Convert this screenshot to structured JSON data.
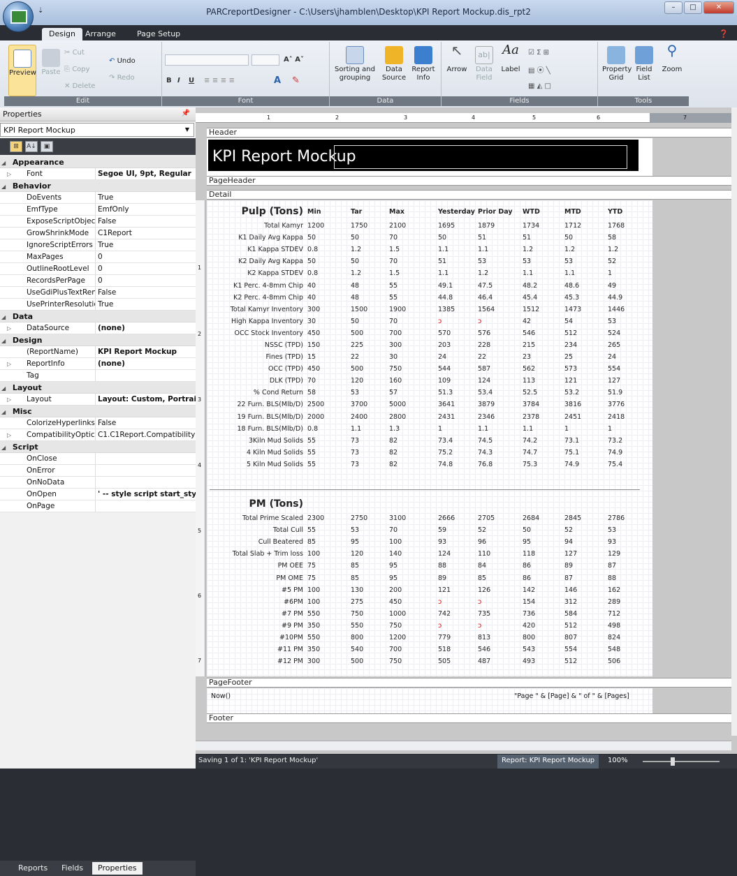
{
  "window": {
    "title": "PARCreportDesigner - C:\\Users\\jhamblen\\Desktop\\KPI Report Mockup.dis_rpt2",
    "qat": "⇣"
  },
  "ribbon_tabs": [
    {
      "label": "Design"
    },
    {
      "label": "Arrange"
    },
    {
      "label": "Page Setup"
    }
  ],
  "ribbon": {
    "edit": {
      "label": "Edit",
      "preview": "Preview",
      "paste": "Paste",
      "cut": "Cut",
      "copy": "Copy",
      "delete": "Delete",
      "undo": "Undo",
      "redo": "Redo"
    },
    "font": {
      "label": "Font",
      "bold": "B",
      "italic": "I",
      "underline": "U"
    },
    "data": {
      "label": "Data",
      "sorting1": "Sorting and",
      "sorting2": "grouping",
      "source1": "Data",
      "source2": "Source",
      "info1": "Report",
      "info2": "Info"
    },
    "fields": {
      "label": "Fields",
      "arrow": "Arrow",
      "datafield1": "Data",
      "datafield2": "Field",
      "label_btn": "Label"
    },
    "tools": {
      "label": "Tools",
      "propgrid1": "Property",
      "propgrid2": "Grid",
      "fieldlist1": "Field",
      "fieldlist2": "List",
      "zoom": "Zoom"
    }
  },
  "properties": {
    "header": "Properties",
    "pin": "ᵖ",
    "object": "KPI Report Mockup",
    "sections": [
      {
        "name": "Appearance",
        "rows": [
          {
            "name": "Font",
            "value": "Segoe UI, 9pt, Regular",
            "bold": true,
            "exp": true
          }
        ]
      },
      {
        "name": "Behavior",
        "rows": [
          {
            "name": "DoEvents",
            "value": "True"
          },
          {
            "name": "EmfType",
            "value": "EmfOnly"
          },
          {
            "name": "ExposeScriptObject",
            "value": "False"
          },
          {
            "name": "GrowShrinkMode",
            "value": "C1Report"
          },
          {
            "name": "IgnoreScriptErrors",
            "value": "True"
          },
          {
            "name": "MaxPages",
            "value": "0"
          },
          {
            "name": "OutlineRootLevel",
            "value": "0"
          },
          {
            "name": "RecordsPerPage",
            "value": "0"
          },
          {
            "name": "UseGdiPlusTextRen",
            "value": "False"
          },
          {
            "name": "UsePrinterResolutic",
            "value": "True"
          }
        ]
      },
      {
        "name": "Data",
        "rows": [
          {
            "name": "DataSource",
            "value": "(none)",
            "bold": true,
            "exp": true
          }
        ]
      },
      {
        "name": "Design",
        "rows": [
          {
            "name": "(ReportName)",
            "value": "KPI Report Mockup",
            "bold": true
          },
          {
            "name": "ReportInfo",
            "value": "(none)",
            "bold": true,
            "exp": true
          },
          {
            "name": "Tag",
            "value": ""
          }
        ]
      },
      {
        "name": "Layout",
        "rows": [
          {
            "name": "Layout",
            "value": "Layout: Custom, Portrait",
            "bold": true,
            "exp": true
          }
        ]
      },
      {
        "name": "Misc",
        "rows": [
          {
            "name": "ColorizeHyperlinks",
            "value": "False"
          },
          {
            "name": "CompatibilityOptic",
            "value": "C1.C1Report.Compatibility",
            "exp": true
          }
        ]
      },
      {
        "name": "Script",
        "rows": [
          {
            "name": "OnClose",
            "value": ""
          },
          {
            "name": "OnError",
            "value": ""
          },
          {
            "name": "OnNoData",
            "value": ""
          },
          {
            "name": "OnOpen",
            "value": "' -- style script start_style",
            "bold": true
          },
          {
            "name": "OnPage",
            "value": ""
          }
        ]
      }
    ]
  },
  "bottom_tabs": [
    {
      "label": "Reports"
    },
    {
      "label": "Fields"
    },
    {
      "label": "Properties"
    }
  ],
  "ruler": [
    "1",
    "2",
    "3",
    "4",
    "5",
    "6",
    "7"
  ],
  "vruler": [
    "1",
    "2",
    "3",
    "4",
    "5",
    "6",
    "7"
  ],
  "bands": {
    "header": "Header",
    "page_header": "PageHeader",
    "detail": "Detail",
    "page_footer": "PageFooter",
    "footer": "Footer"
  },
  "report": {
    "title": "KPI Report Mockup",
    "columns": [
      "Min",
      "Tar",
      "Max",
      "Yesterday",
      "Prior Day",
      "WTD",
      "MTD",
      "YTD"
    ],
    "pulp": {
      "title": "Pulp (Tons)",
      "rows": [
        [
          "Total Kamyr",
          "1200",
          "1750",
          "2100",
          "1695",
          "1879",
          "1734",
          "1712",
          "1768"
        ],
        [
          "K1 Daily Avg Kappa",
          "50",
          "50",
          "70",
          "50",
          "51",
          "51",
          "50",
          "58"
        ],
        [
          "K1 Kappa STDEV",
          "0.8",
          "1.2",
          "1.5",
          "1.1",
          "1.1",
          "1.2",
          "1.2",
          "1.2"
        ],
        [
          "K2 Daily Avg Kappa",
          "50",
          "50",
          "70",
          "51",
          "53",
          "53",
          "53",
          "52"
        ],
        [
          "K2 Kappa STDEV",
          "0.8",
          "1.2",
          "1.5",
          "1.1",
          "1.2",
          "1.1",
          "1.1",
          "1"
        ],
        [
          "K1 Perc. 4-8mm Chip",
          "40",
          "48",
          "55",
          "49.1",
          "47.5",
          "48.2",
          "48.6",
          "49"
        ],
        [
          "K2 Perc. 4-8mm Chip",
          "40",
          "48",
          "55",
          "44.8",
          "46.4",
          "45.4",
          "45.3",
          "44.9"
        ],
        [
          "Total Kamyr Inventory",
          "300",
          "1500",
          "1900",
          "1385",
          "1564",
          "1512",
          "1473",
          "1446"
        ],
        [
          "High Kappa Inventory",
          "30",
          "50",
          "70",
          "0",
          "0",
          "42",
          "54",
          "53"
        ],
        [
          "OCC Stock Inventory",
          "450",
          "500",
          "700",
          "570",
          "576",
          "546",
          "512",
          "524"
        ],
        [
          "NSSC (TPD)",
          "150",
          "225",
          "300",
          "203",
          "228",
          "215",
          "234",
          "265"
        ],
        [
          "Fines (TPD)",
          "15",
          "22",
          "30",
          "24",
          "22",
          "23",
          "25",
          "24"
        ],
        [
          "OCC (TPD)",
          "450",
          "500",
          "750",
          "544",
          "587",
          "562",
          "573",
          "554"
        ],
        [
          "DLK (TPD)",
          "70",
          "120",
          "160",
          "109",
          "124",
          "113",
          "121",
          "127"
        ],
        [
          "% Cond Return",
          "58",
          "53",
          "57",
          "51.3",
          "53.4",
          "52.5",
          "53.2",
          "51.9"
        ],
        [
          "22 Furn. BLS(Mlb/D)",
          "2500",
          "3700",
          "5000",
          "3641",
          "3879",
          "3784",
          "3816",
          "3776"
        ],
        [
          "19 Furn. BLS(Mlb/D)",
          "2000",
          "2400",
          "2800",
          "2431",
          "2346",
          "2378",
          "2451",
          "2418"
        ],
        [
          "18 Furn. BLS(Mlb/D)",
          "0.8",
          "1.1",
          "1.3",
          "1",
          "1.1",
          "1.1",
          "1",
          "1"
        ],
        [
          "3Kiln Mud Solids",
          "55",
          "73",
          "82",
          "73.4",
          "74.5",
          "74.2",
          "73.1",
          "73.2"
        ],
        [
          "4 Kiln Mud Solids",
          "55",
          "73",
          "82",
          "75.2",
          "74.3",
          "74.7",
          "75.1",
          "74.9"
        ],
        [
          "5 Kiln Mud Solids",
          "55",
          "73",
          "82",
          "74.8",
          "76.8",
          "75.3",
          "74.9",
          "75.4"
        ]
      ]
    },
    "pm": {
      "title": "PM (Tons)",
      "rows": [
        [
          "Total Prime Scaled",
          "2300",
          "2750",
          "3100",
          "2666",
          "2705",
          "2684",
          "2845",
          "2786"
        ],
        [
          "Total Cull",
          "55",
          "53",
          "70",
          "59",
          "52",
          "50",
          "52",
          "53"
        ],
        [
          "Cull Beatered",
          "85",
          "95",
          "100",
          "93",
          "96",
          "95",
          "94",
          "93"
        ],
        [
          "Total Slab + Trim loss",
          "100",
          "120",
          "140",
          "124",
          "110",
          "118",
          "127",
          "129"
        ],
        [
          "PM OEE",
          "75",
          "85",
          "95",
          "88",
          "84",
          "86",
          "89",
          "87"
        ],
        [
          "PM OME",
          "75",
          "85",
          "95",
          "89",
          "85",
          "86",
          "87",
          "88"
        ],
        [
          "#5 PM",
          "100",
          "130",
          "200",
          "121",
          "126",
          "142",
          "146",
          "162"
        ],
        [
          "#6PM",
          "100",
          "275",
          "450",
          "0",
          "0",
          "154",
          "312",
          "289"
        ],
        [
          "#7 PM",
          "550",
          "750",
          "1000",
          "742",
          "735",
          "736",
          "584",
          "712"
        ],
        [
          "#9 PM",
          "350",
          "550",
          "750",
          "0",
          "0",
          "420",
          "512",
          "498"
        ],
        [
          "#10PM",
          "550",
          "800",
          "1200",
          "779",
          "813",
          "800",
          "807",
          "824"
        ],
        [
          "#11 PM",
          "350",
          "540",
          "700",
          "518",
          "546",
          "543",
          "554",
          "548"
        ],
        [
          "#12 PM",
          "300",
          "500",
          "750",
          "505",
          "487",
          "493",
          "512",
          "506"
        ]
      ]
    },
    "footer_left": "Now()",
    "footer_right": "\"Page \" & [Page] & \" of \" & [Pages]"
  },
  "status": {
    "text": "Saving 1 of 1: 'KPI Report Mockup'",
    "report": "Report: KPI Report Mockup",
    "zoom": "100%"
  }
}
